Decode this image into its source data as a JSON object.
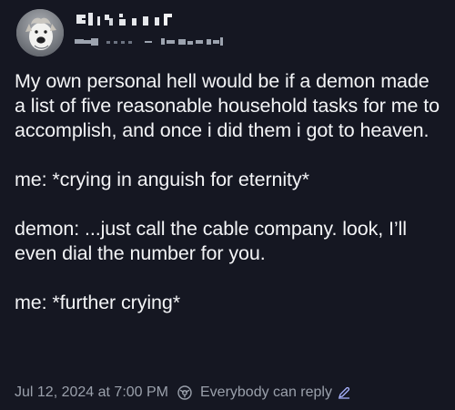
{
  "post": {
    "paragraphs": [
      "My own personal hell would be if a demon made a list of five reasonable household tasks for me to accomplish, and once i did them i got to heaven.",
      "me: *crying in anguish for eternity*",
      "demon: ...just call the cable company. look, I’ll even dial the number for you.",
      "me: *further crying*"
    ],
    "timestamp": "Jul 12, 2024 at 7:00 PM",
    "reply_setting": "Everybody can reply"
  },
  "icons": {
    "avatar": "dog-avatar",
    "reply": "reply-settings-icon",
    "edit": "pencil-icon"
  },
  "colors": {
    "background": "#151722",
    "text": "#f3f4f6",
    "muted": "#9aa0ab",
    "accent": "#a9b3ff"
  }
}
